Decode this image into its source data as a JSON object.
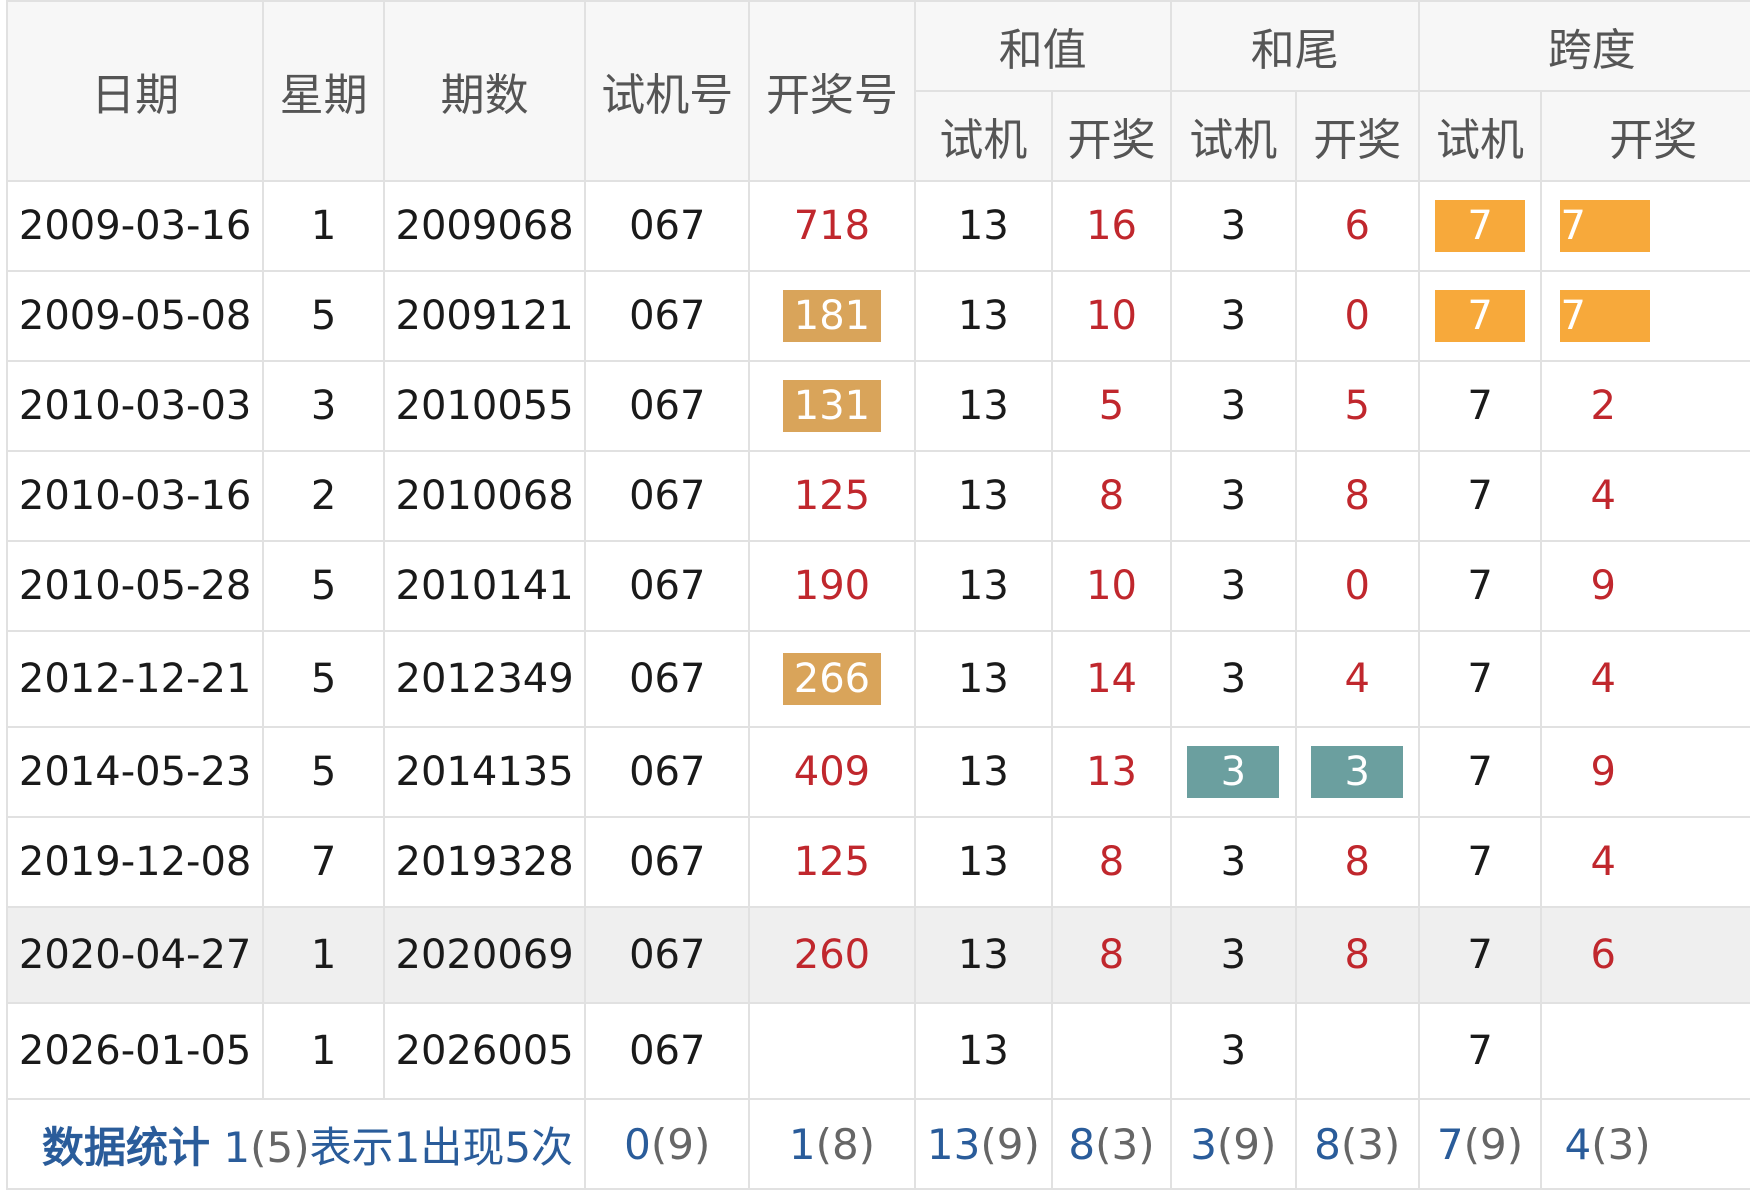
{
  "header": {
    "date": "日期",
    "weekday": "星期",
    "period": "期数",
    "test_number": "试机号",
    "draw_number": "开奖号",
    "sum": "和值",
    "sum_tail": "和尾",
    "span": "跨度",
    "sub_test": "试机",
    "sub_draw": "开奖"
  },
  "rows": [
    {
      "date": "2009-03-16",
      "weekday": "1",
      "period": "2009068",
      "test": "067",
      "draw": "718",
      "sum_test": "13",
      "sum_draw": "16",
      "tail_test": "3",
      "tail_draw": "6",
      "span_test": "7",
      "span_draw": "7"
    },
    {
      "date": "2009-05-08",
      "weekday": "5",
      "period": "2009121",
      "test": "067",
      "draw": "181",
      "sum_test": "13",
      "sum_draw": "10",
      "tail_test": "3",
      "tail_draw": "0",
      "span_test": "7",
      "span_draw": "7"
    },
    {
      "date": "2010-03-03",
      "weekday": "3",
      "period": "2010055",
      "test": "067",
      "draw": "131",
      "sum_test": "13",
      "sum_draw": "5",
      "tail_test": "3",
      "tail_draw": "5",
      "span_test": "7",
      "span_draw": "2"
    },
    {
      "date": "2010-03-16",
      "weekday": "2",
      "period": "2010068",
      "test": "067",
      "draw": "125",
      "sum_test": "13",
      "sum_draw": "8",
      "tail_test": "3",
      "tail_draw": "8",
      "span_test": "7",
      "span_draw": "4"
    },
    {
      "date": "2010-05-28",
      "weekday": "5",
      "period": "2010141",
      "test": "067",
      "draw": "190",
      "sum_test": "13",
      "sum_draw": "10",
      "tail_test": "3",
      "tail_draw": "0",
      "span_test": "7",
      "span_draw": "9"
    },
    {
      "date": "2012-12-21",
      "weekday": "5",
      "period": "2012349",
      "test": "067",
      "draw": "266",
      "sum_test": "13",
      "sum_draw": "14",
      "tail_test": "3",
      "tail_draw": "4",
      "span_test": "7",
      "span_draw": "4"
    },
    {
      "date": "2014-05-23",
      "weekday": "5",
      "period": "2014135",
      "test": "067",
      "draw": "409",
      "sum_test": "13",
      "sum_draw": "13",
      "tail_test": "3",
      "tail_draw": "3",
      "span_test": "7",
      "span_draw": "9"
    },
    {
      "date": "2019-12-08",
      "weekday": "7",
      "period": "2019328",
      "test": "067",
      "draw": "125",
      "sum_test": "13",
      "sum_draw": "8",
      "tail_test": "3",
      "tail_draw": "8",
      "span_test": "7",
      "span_draw": "4"
    },
    {
      "date": "2020-04-27",
      "weekday": "1",
      "period": "2020069",
      "test": "067",
      "draw": "260",
      "sum_test": "13",
      "sum_draw": "8",
      "tail_test": "3",
      "tail_draw": "8",
      "span_test": "7",
      "span_draw": "6"
    },
    {
      "date": "2026-01-05",
      "weekday": "1",
      "period": "2026005",
      "test": "067",
      "draw": "",
      "sum_test": "13",
      "sum_draw": "",
      "tail_test": "3",
      "tail_draw": "",
      "span_test": "7",
      "span_draw": ""
    }
  ],
  "stats": {
    "title": "数据统计",
    "hint_prefix": "1",
    "hint_paren": "(5)",
    "hint_suffix": "表示1出现5次",
    "test": {
      "value": "0",
      "count": "(9)"
    },
    "draw": {
      "value": "1",
      "count": "(8)"
    },
    "sum_test": {
      "value": "13",
      "count": "(9)"
    },
    "sum_draw": {
      "value": "8",
      "count": "(3)"
    },
    "tail_test": {
      "value": "3",
      "count": "(9)"
    },
    "tail_draw": {
      "value": "8",
      "count": "(3)"
    },
    "span_test": {
      "value": "7",
      "count": "(9)"
    },
    "span_draw": {
      "value": "4",
      "count": "(3)"
    }
  },
  "colors": {
    "draw_text": "#c0272d",
    "badge_tan": "#d9a45a",
    "badge_orange": "#f7a93b",
    "badge_teal": "#6b9f9f",
    "stats_blue": "#2a5c9a",
    "highlight_row": "#efefef"
  }
}
